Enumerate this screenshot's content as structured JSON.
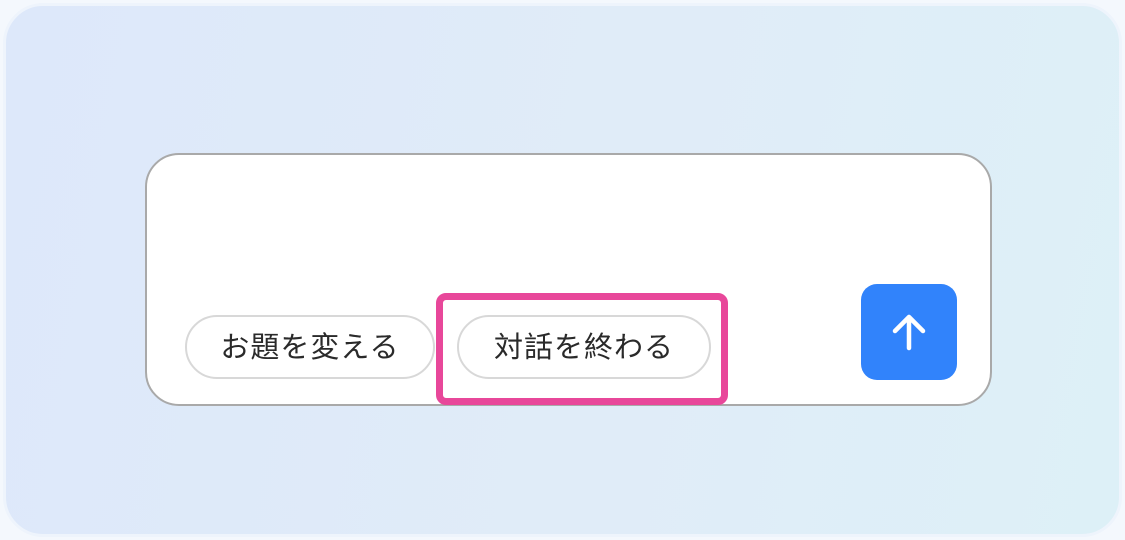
{
  "composer": {
    "input_value": "",
    "chips": {
      "change_topic": "お題を変える",
      "end_conversation": "対話を終わる"
    },
    "send_icon": "arrow-up-icon"
  },
  "colors": {
    "send_button": "#3183fb",
    "highlight": "#e8479a",
    "background": "#dde8fa"
  }
}
